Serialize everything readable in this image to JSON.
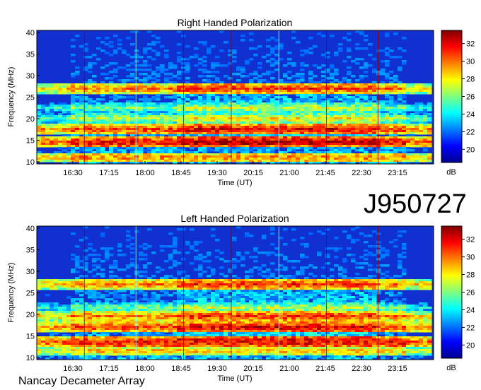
{
  "figure": {
    "observation_id": "J950727",
    "instrument": "Nancay Decameter Array"
  },
  "chart_data": [
    {
      "type": "heatmap",
      "title": "Right Handed Polarization",
      "xlabel": "Time (UT)",
      "ylabel": "Frequency (MHz)",
      "x_ticks": [
        "16:30",
        "17:15",
        "18:00",
        "18:45",
        "19:30",
        "20:15",
        "21:00",
        "21:45",
        "22:30",
        "23:15"
      ],
      "y_ticks": [
        "10",
        "15",
        "20",
        "25",
        "30",
        "35",
        "40"
      ],
      "ylim": [
        9.5,
        40.5
      ],
      "colorbar": {
        "label": "dB",
        "ticks": [
          "20",
          "22",
          "24",
          "26",
          "28",
          "30",
          "32"
        ],
        "range": [
          18.5,
          33.5
        ]
      },
      "bands": [
        {
          "freq": 11,
          "level": 30
        },
        {
          "freq": 14.5,
          "level": 32
        },
        {
          "freq": 17.5,
          "level": 31
        },
        {
          "freq": 20,
          "level": 27
        },
        {
          "freq": 22.5,
          "level": 26
        },
        {
          "freq": 27,
          "level": 30
        }
      ]
    },
    {
      "type": "heatmap",
      "title": "Left Handed Polarization",
      "xlabel": "Time (UT)",
      "ylabel": "Frequency (MHz)",
      "x_ticks": [
        "16:30",
        "17:15",
        "18:00",
        "18:45",
        "19:30",
        "20:15",
        "21:00",
        "21:45",
        "22:30",
        "23:15"
      ],
      "y_ticks": [
        "10",
        "15",
        "20",
        "25",
        "30",
        "35",
        "40"
      ],
      "ylim": [
        9.5,
        40.5
      ],
      "colorbar": {
        "label": "dB",
        "ticks": [
          "20",
          "22",
          "24",
          "26",
          "28",
          "30",
          "32"
        ],
        "range": [
          18.5,
          33.5
        ]
      },
      "bands": [
        {
          "freq": 11.5,
          "level": 29
        },
        {
          "freq": 13.5,
          "level": 32
        },
        {
          "freq": 17,
          "level": 31
        },
        {
          "freq": 19.5,
          "level": 30
        },
        {
          "freq": 21.5,
          "level": 26
        },
        {
          "freq": 27,
          "level": 30
        }
      ]
    }
  ]
}
